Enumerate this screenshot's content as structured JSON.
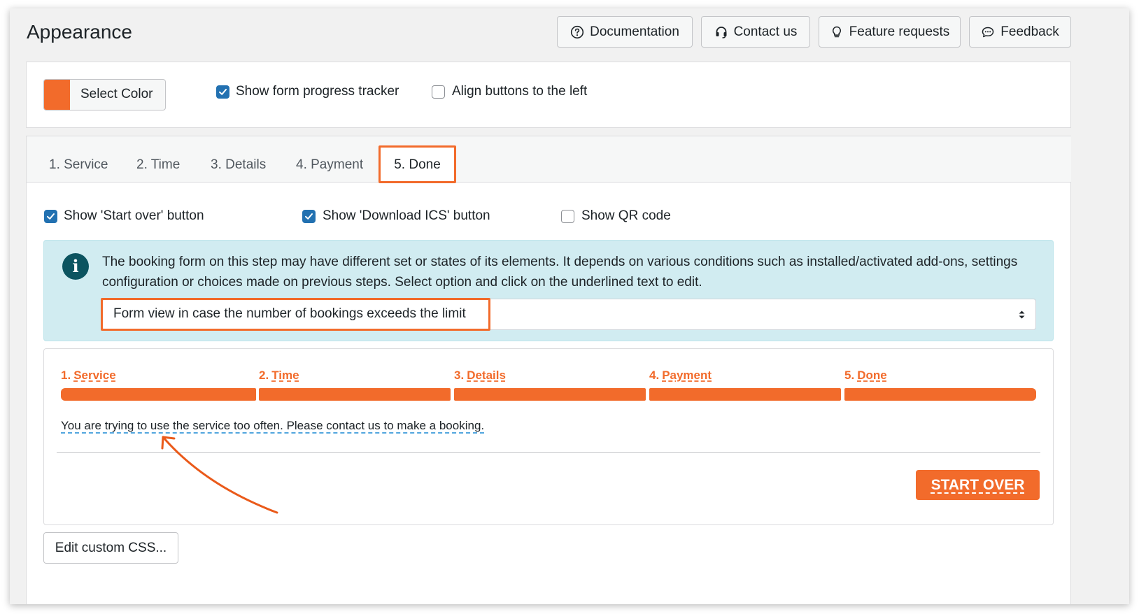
{
  "page": {
    "title": "Appearance"
  },
  "header_buttons": {
    "documentation": "Documentation",
    "contact": "Contact us",
    "feature_requests": "Feature requests",
    "feedback": "Feedback"
  },
  "settings": {
    "select_color_label": "Select Color",
    "color": "#f26b2b",
    "show_progress_tracker": {
      "label": "Show form progress tracker",
      "checked": true
    },
    "align_buttons_left": {
      "label": "Align buttons to the left",
      "checked": false
    }
  },
  "tabs": [
    {
      "label": "1. Service",
      "active": false
    },
    {
      "label": "2. Time",
      "active": false
    },
    {
      "label": "3. Details",
      "active": false
    },
    {
      "label": "4. Payment",
      "active": false
    },
    {
      "label": "5. Done",
      "active": true
    }
  ],
  "done_options": [
    {
      "label": "Show 'Start over' button",
      "checked": true
    },
    {
      "label": "Show 'Download ICS' button",
      "checked": true
    },
    {
      "label": "Show QR code",
      "checked": false
    }
  ],
  "info": {
    "icon": "info-icon",
    "text": "The booking form on this step may have different set or states of its elements. It depends on various conditions such as installed/activated add-ons, settings configuration or choices made on previous steps. Select option and click on the underlined text to edit.",
    "select_value": "Form view in case the number of bookings exceeds the limit"
  },
  "preview": {
    "steps": [
      {
        "num": "1.",
        "label": "Service"
      },
      {
        "num": "2.",
        "label": "Time"
      },
      {
        "num": "3.",
        "label": "Details"
      },
      {
        "num": "4.",
        "label": "Payment"
      },
      {
        "num": "5.",
        "label": "Done"
      }
    ],
    "message": "You are trying to use the service too often. Please contact us to make a booking.",
    "start_over": "START OVER"
  },
  "edit_css_label": "Edit custom CSS...",
  "colors": {
    "accent": "#f26b2b",
    "checkbox_blue": "#2271b1",
    "info_bg": "#d1ecf1"
  }
}
